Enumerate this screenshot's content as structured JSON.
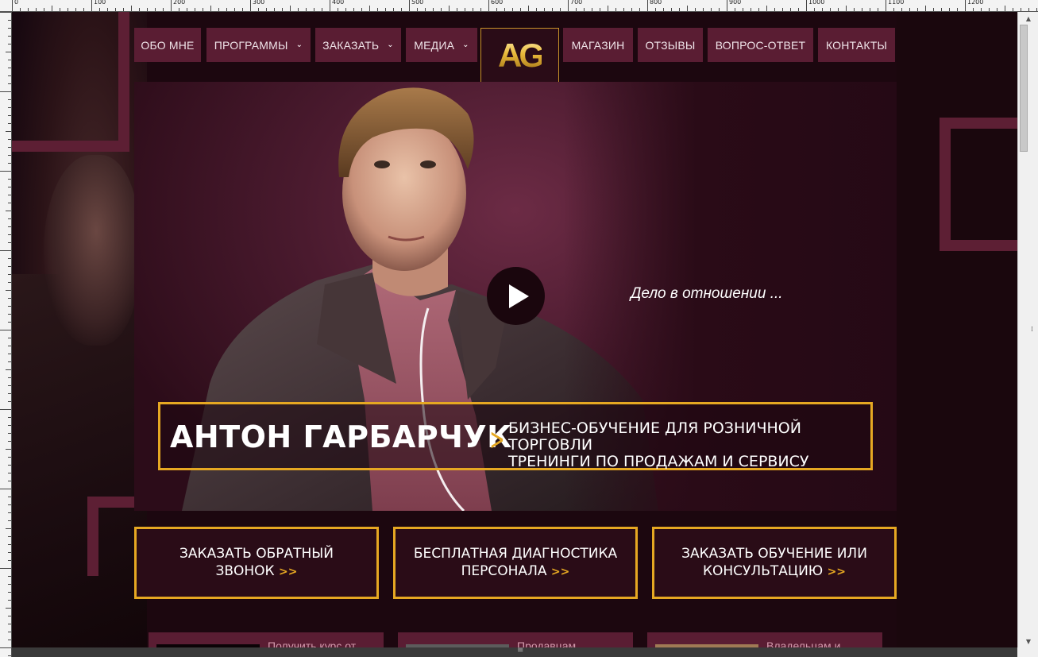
{
  "ruler": {
    "labels": [
      "0",
      "100",
      "200",
      "300",
      "400",
      "500",
      "600",
      "700",
      "800",
      "900",
      "1000",
      "1100",
      "1200"
    ]
  },
  "nav": {
    "items": [
      {
        "label": "ОБО МНЕ",
        "dropdown": false
      },
      {
        "label": "ПРОГРАММЫ",
        "dropdown": true
      },
      {
        "label": "ЗАКАЗАТЬ",
        "dropdown": true
      },
      {
        "label": "МЕДИА",
        "dropdown": true
      },
      {
        "label": "МАГАЗИН",
        "dropdown": false
      },
      {
        "label": "ОТЗЫВЫ",
        "dropdown": false
      },
      {
        "label": "ВОПРОС-ОТВЕТ",
        "dropdown": false
      },
      {
        "label": "КОНТАКТЫ",
        "dropdown": false
      }
    ],
    "chevron": "⌄",
    "logo_text": "AG"
  },
  "hero": {
    "tagline": "Дело в отношении ...",
    "name": "АНТОН ГАРБАРЧУК",
    "arrow": ">",
    "subline1": "БИЗНЕС-ОБУЧЕНИЕ ДЛЯ РОЗНИЧНОЙ ТОРГОВЛИ",
    "subline2": "ТРЕНИНГИ ПО ПРОДАЖАМ И СЕРВИСУ"
  },
  "cta": [
    {
      "line1": "ЗАКАЗАТЬ ОБРАТНЫЙ",
      "line2": "ЗВОНОК",
      "arrow": ">>"
    },
    {
      "line1": "БЕСПЛАТНАЯ ДИАГНОСТИКА",
      "line2": "ПЕРСОНАЛА",
      "arrow": ">>"
    },
    {
      "line1": "ЗАКАЗАТЬ ОБУЧЕНИЕ ИЛИ",
      "line2": "КОНСУЛЬТАЦИЮ",
      "arrow": ">>"
    }
  ],
  "cards": [
    {
      "text": "Получить курс от"
    },
    {
      "text": "Продавцам"
    },
    {
      "text": "Владельцам и"
    }
  ],
  "colors": {
    "accent": "#e6a822",
    "nav_bg": "#5a1d33",
    "page_bg": "#1c070f"
  },
  "icons": {
    "play": "play-icon",
    "scroll_up": "▲",
    "scroll_down": "▼",
    "grip": "⁞",
    "hgrip": "≡"
  }
}
